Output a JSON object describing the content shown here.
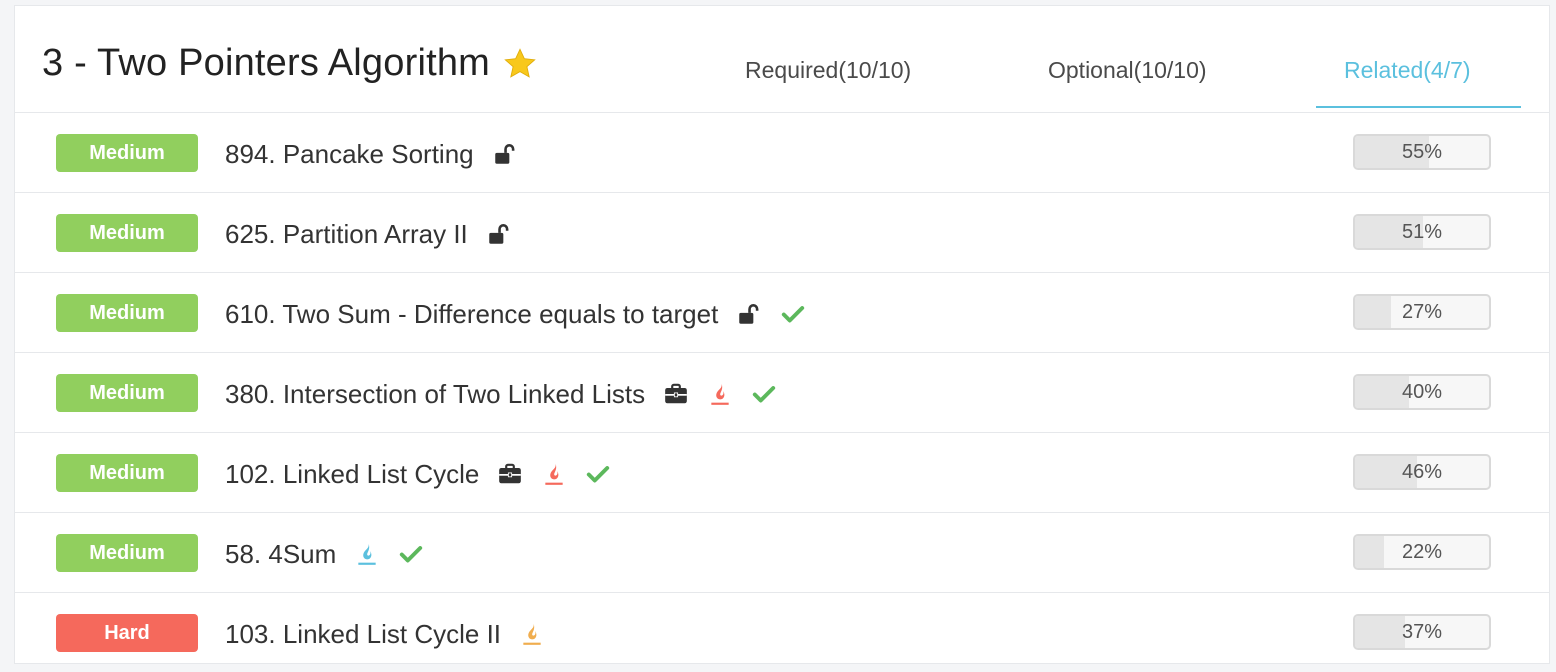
{
  "header": {
    "title": "3 - Two Pointers Algorithm",
    "tabs": [
      {
        "label": "Required(10/10)",
        "active": false
      },
      {
        "label": "Optional(10/10)",
        "active": false
      },
      {
        "label": "Related(4/7)",
        "active": true
      }
    ]
  },
  "colors": {
    "medium": "#91cf5e",
    "hard": "#f5695c",
    "accent": "#5bc0de",
    "check": "#5cb85c",
    "flame_red": "#f5695c",
    "flame_blue": "#5bc0de",
    "flame_yellow": "#f0ad4e"
  },
  "problems": [
    {
      "difficulty": "Medium",
      "title": "894. Pancake Sorting",
      "icons": [
        "unlock-icon"
      ],
      "acceptance": "55%",
      "acceptance_value": 55
    },
    {
      "difficulty": "Medium",
      "title": "625. Partition Array II",
      "icons": [
        "unlock-icon"
      ],
      "acceptance": "51%",
      "acceptance_value": 51
    },
    {
      "difficulty": "Medium",
      "title": "610. Two Sum - Difference equals to target",
      "icons": [
        "unlock-icon",
        "check-icon"
      ],
      "acceptance": "27%",
      "acceptance_value": 27
    },
    {
      "difficulty": "Medium",
      "title": "380. Intersection of Two Linked Lists",
      "icons": [
        "briefcase-icon",
        "flame-red-icon",
        "check-icon"
      ],
      "acceptance": "40%",
      "acceptance_value": 40
    },
    {
      "difficulty": "Medium",
      "title": "102. Linked List Cycle",
      "icons": [
        "briefcase-icon",
        "flame-red-icon",
        "check-icon"
      ],
      "acceptance": "46%",
      "acceptance_value": 46
    },
    {
      "difficulty": "Medium",
      "title": "58. 4Sum",
      "icons": [
        "flame-blue-icon",
        "check-icon"
      ],
      "acceptance": "22%",
      "acceptance_value": 22
    },
    {
      "difficulty": "Hard",
      "title": "103. Linked List Cycle II",
      "icons": [
        "flame-yellow-icon"
      ],
      "acceptance": "37%",
      "acceptance_value": 37
    }
  ]
}
